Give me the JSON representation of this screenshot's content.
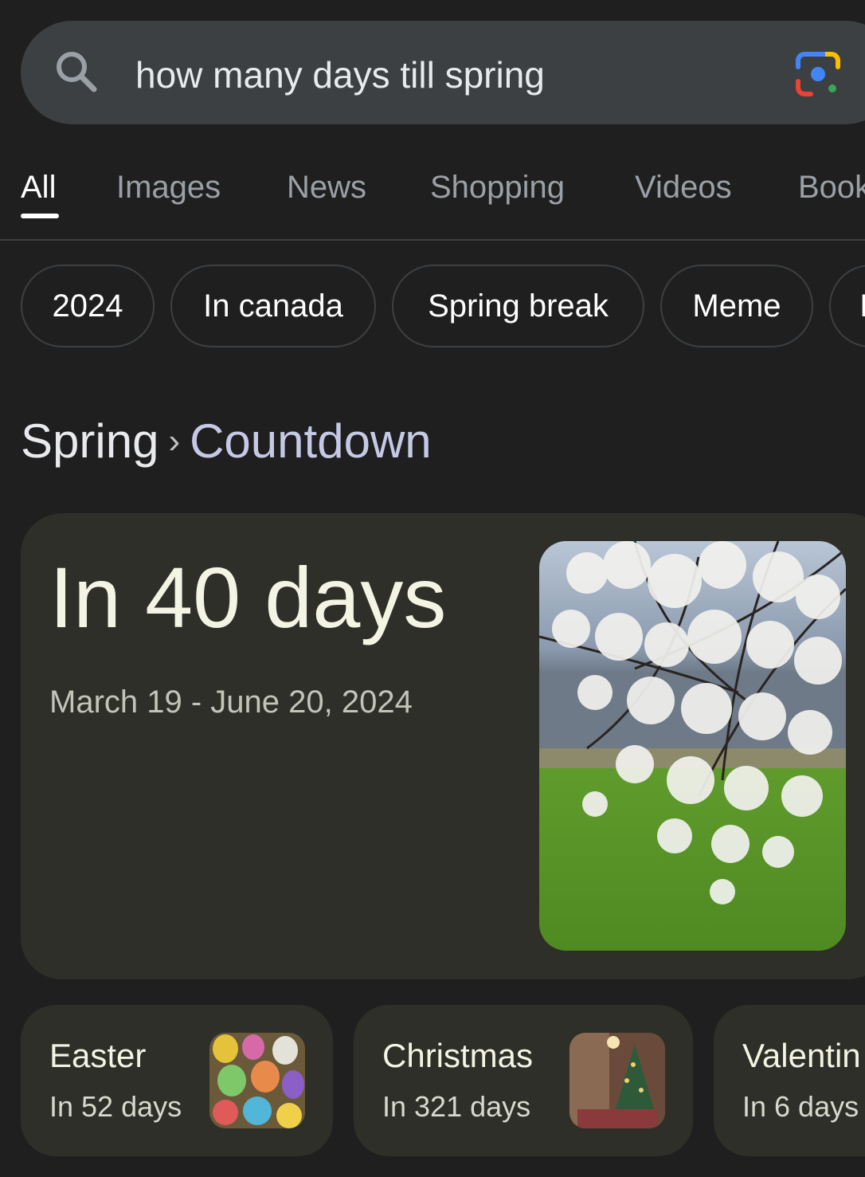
{
  "search": {
    "query": "how many days till spring",
    "icon": "search-icon",
    "lens_icon": "google-lens-icon"
  },
  "tabs": [
    {
      "label": "All",
      "active": true
    },
    {
      "label": "Images",
      "active": false
    },
    {
      "label": "News",
      "active": false
    },
    {
      "label": "Shopping",
      "active": false
    },
    {
      "label": "Videos",
      "active": false
    },
    {
      "label": "Book",
      "active": false
    }
  ],
  "chips": [
    {
      "label": "2024"
    },
    {
      "label": "In canada"
    },
    {
      "label": "Spring break"
    },
    {
      "label": "Meme"
    },
    {
      "label": "I"
    }
  ],
  "breadcrumb": {
    "root": "Spring",
    "separator": "›",
    "current": "Countdown"
  },
  "main": {
    "countdown": "In 40 days",
    "date_range": "March 19 - June 20, 2024",
    "image": "cherry-blossom-photo"
  },
  "events": [
    {
      "title": "Easter",
      "subtitle": "In 52 days",
      "image": "easter-eggs-thumbnail"
    },
    {
      "title": "Christmas",
      "subtitle": "In 321 days",
      "image": "christmas-tree-thumbnail"
    },
    {
      "title": "Valentin",
      "subtitle": "In 6 days"
    }
  ],
  "colors": {
    "background": "#1f1f1f",
    "search_bar": "#3c4043",
    "card": "#2e2f29",
    "breadcrumb_accent": "#c6c9e6"
  }
}
